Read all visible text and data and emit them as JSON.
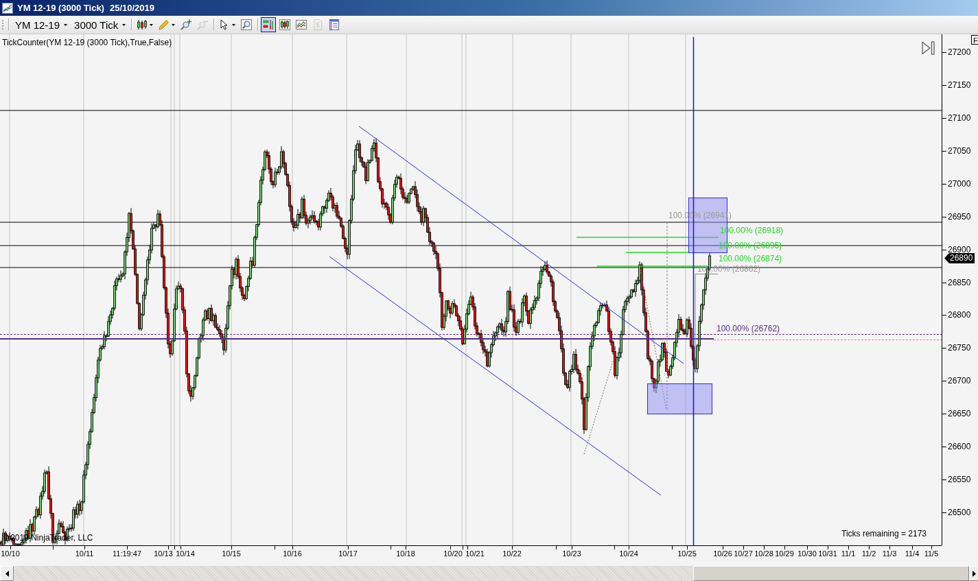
{
  "window": {
    "title": "YM 12-19 (3000 Tick)",
    "date": "25/10/2019"
  },
  "toolbar": {
    "instrument": "YM 12-19",
    "interval": "3000 Tick",
    "buttons": [
      {
        "kind": "chart-style",
        "menu": true,
        "selected": false,
        "disabled": false
      },
      {
        "kind": "drawing-tool",
        "menu": true,
        "selected": false,
        "disabled": false
      },
      {
        "kind": "zoom-in",
        "menu": false,
        "selected": false,
        "disabled": false
      },
      {
        "kind": "zoom-out",
        "menu": false,
        "selected": false,
        "disabled": true
      },
      {
        "kind": "pointer",
        "menu": true,
        "selected": false,
        "disabled": false
      },
      {
        "kind": "zoom-box",
        "menu": false,
        "selected": false,
        "disabled": false
      },
      {
        "kind": "data-box",
        "menu": false,
        "selected": true,
        "disabled": false
      },
      {
        "kind": "bar-type",
        "menu": false,
        "selected": false,
        "disabled": false
      },
      {
        "kind": "indicators",
        "menu": false,
        "selected": false,
        "disabled": false
      },
      {
        "kind": "strategies",
        "menu": false,
        "selected": false,
        "disabled": true
      },
      {
        "kind": "properties",
        "menu": false,
        "selected": false,
        "disabled": false
      }
    ]
  },
  "chart": {
    "indicator_label": "TickCounter(YM 12-19 (3000 Tick),True,False)",
    "corner_button": "F",
    "price_axis": [
      "27200",
      "27150",
      "27100",
      "27050",
      "27000",
      "26950",
      "26900",
      "26850",
      "26800",
      "26750",
      "26700",
      "26650",
      "26600",
      "26550",
      "26500"
    ],
    "last_price": "26890",
    "time_axis": [
      "10/10",
      "10/11",
      "11:19:47",
      "10/13",
      "10/14",
      "10/15",
      "10/16",
      "10/17",
      "10/18",
      "10/20",
      "10/21",
      "10/22",
      "10/23",
      "10/24",
      "10/25",
      "10/26",
      "10/27",
      "10/28",
      "10/29",
      "10/30",
      "10/31",
      "11/1",
      "11/2",
      "11/3",
      "11/4",
      "11/5"
    ],
    "level_labels": [
      {
        "text": "100.00% (26941)",
        "color": "#999999"
      },
      {
        "text": "100.00% (26918)",
        "color": "#22dd22"
      },
      {
        "text": "100.00% (26895)",
        "color": "#22dd22"
      },
      {
        "text": "100.00% (26874)",
        "color": "#22dd22"
      },
      {
        "text": "100.00% (26862)",
        "color": "#999999"
      },
      {
        "text": "100.00% (26762)",
        "color": "#5b2c83"
      }
    ],
    "copyright": "© 2019 NinjaTrader, LLC",
    "ticks_remaining": "Ticks remaining = 2173"
  }
}
